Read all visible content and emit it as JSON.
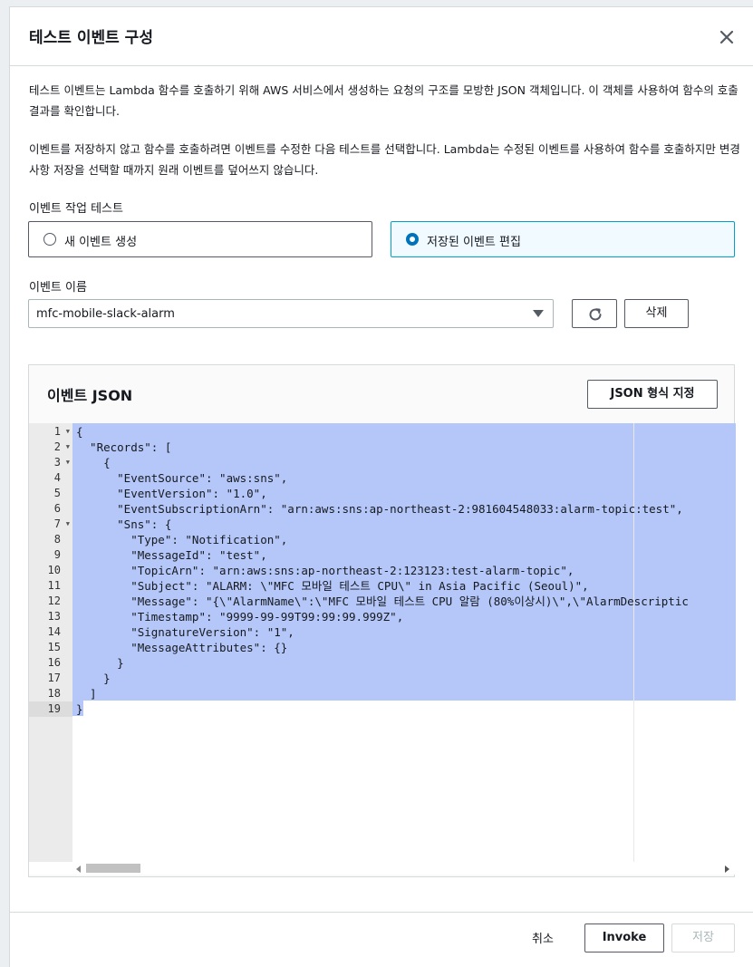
{
  "modal": {
    "title": "테스트 이벤트 구성",
    "description1": "테스트 이벤트는 Lambda 함수를 호출하기 위해 AWS 서비스에서 생성하는 요청의 구조를 모방한 JSON 객체입니다. 이 객체를 사용하여 함수의 호출 결과를 확인합니다.",
    "description2": "이벤트를 저장하지 않고 함수를 호출하려면 이벤트를 수정한 다음 테스트를 선택합니다. Lambda는 수정된 이벤트를 사용하여 함수를 호출하지만 변경 사항 저장을 선택할 때까지 원래 이벤트를 덮어쓰지 않습니다."
  },
  "event_action": {
    "label": "이벤트 작업 테스트",
    "options": [
      {
        "label": "새 이벤트 생성",
        "selected": false
      },
      {
        "label": "저장된 이벤트 편집",
        "selected": true
      }
    ]
  },
  "event_name": {
    "label": "이벤트 이름",
    "selected": "mfc-mobile-slack-alarm",
    "delete_label": "삭제",
    "refresh_icon": "refresh-icon"
  },
  "json_panel": {
    "title": "이벤트 JSON",
    "format_button": "JSON 형식 지정",
    "lines": [
      "{",
      "  \"Records\": [",
      "    {",
      "      \"EventSource\": \"aws:sns\",",
      "      \"EventVersion\": \"1.0\",",
      "      \"EventSubscriptionArn\": \"arn:aws:sns:ap-northeast-2:981604548033:alarm-topic:test\",",
      "      \"Sns\": {",
      "        \"Type\": \"Notification\",",
      "        \"MessageId\": \"test\",",
      "        \"TopicArn\": \"arn:aws:sns:ap-northeast-2:123123:test-alarm-topic\",",
      "        \"Subject\": \"ALARM: \\\"MFC 모바일 테스트 CPU\\\" in Asia Pacific (Seoul)\",",
      "        \"Message\": \"{\\\"AlarmName\\\":\\\"MFC 모바일 테스트 CPU 알람 (80%이상시)\\\",\\\"AlarmDescriptic",
      "        \"Timestamp\": \"9999-99-99T99:99:99.999Z\",",
      "        \"SignatureVersion\": \"1\",",
      "        \"MessageAttributes\": {}",
      "      }",
      "    }",
      "  ]",
      "}"
    ],
    "line_numbers": [
      "1",
      "2",
      "3",
      "4",
      "5",
      "6",
      "7",
      "8",
      "9",
      "10",
      "11",
      "12",
      "13",
      "14",
      "15",
      "16",
      "17",
      "18",
      "19"
    ],
    "foldable_lines": [
      1,
      2,
      3,
      7
    ]
  },
  "footer": {
    "cancel": "취소",
    "invoke": "Invoke",
    "save": "저장"
  },
  "colors": {
    "selection": "#b5c7f9",
    "radio_selected_border": "#00a1c9",
    "radio_dot": "#0073bb"
  }
}
